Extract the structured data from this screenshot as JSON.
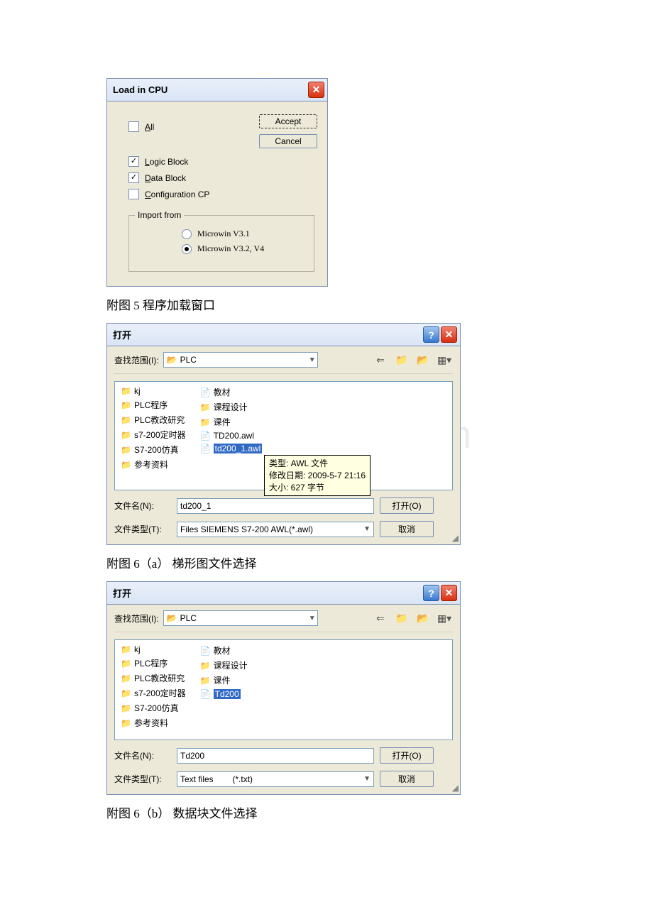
{
  "watermark": "www.bdocx.com",
  "load_dialog": {
    "title": "Load in CPU",
    "all": {
      "label_pre": "A",
      "label_post": "ll",
      "checked": false
    },
    "logic": {
      "label_pre": "L",
      "label_post": "ogic Block",
      "checked": true
    },
    "data": {
      "label_pre": "D",
      "label_post": "ata Block",
      "checked": true
    },
    "config": {
      "label_pre": "C",
      "label_post": "onfiguration CP",
      "checked": false
    },
    "accept": "Accept",
    "cancel": "Cancel",
    "import_legend": "Import from",
    "radio1": {
      "label": "Microwin V3.1",
      "checked": false
    },
    "radio2": {
      "label": "Microwin V3.2, V4",
      "checked": true
    }
  },
  "caption1": "附图 5 程序加载窗口",
  "open1": {
    "title": "打开",
    "range_label": "查找范围(I):",
    "range_value": "PLC",
    "col1": [
      "kj",
      "PLC程序",
      "PLC教改研究",
      "s7-200定时器",
      "S7-200仿真",
      "参考资料"
    ],
    "col2": [
      {
        "icon": "doc",
        "text": "教材"
      },
      {
        "icon": "folder",
        "text": "课程设计"
      },
      {
        "icon": "folder",
        "text": "课件"
      },
      {
        "icon": "doc",
        "text": "TD200.awl"
      },
      {
        "icon": "doc",
        "text": "td200_1.awl",
        "selected": true
      }
    ],
    "tooltip": {
      "l1": "类型: AWL 文件",
      "l2": "修改日期: 2009-5-7 21:16",
      "l3": "大小: 627 字节"
    },
    "filename_label": "文件名(N):",
    "filename_value": "td200_1",
    "filetype_label": "文件类型(T):",
    "filetype_value": "Files SIEMENS S7-200 AWL(*.awl)",
    "open_btn": "打开(O)",
    "cancel_btn": "取消"
  },
  "caption2": "附图 6（a） 梯形图文件选择",
  "open2": {
    "title": "打开",
    "range_label": "查找范围(I):",
    "range_value": "PLC",
    "col1": [
      "kj",
      "PLC程序",
      "PLC教改研究",
      "s7-200定时器",
      "S7-200仿真",
      "参考资料"
    ],
    "col2": [
      {
        "icon": "doc",
        "text": "教材"
      },
      {
        "icon": "folder",
        "text": "课程设计"
      },
      {
        "icon": "folder",
        "text": "课件"
      },
      {
        "icon": "txt",
        "text": "Td200",
        "selected": true
      }
    ],
    "filename_label": "文件名(N):",
    "filename_value": "Td200",
    "filetype_label": "文件类型(T):",
    "filetype_value": "Text files        (*.txt)",
    "open_btn": "打开(O)",
    "cancel_btn": "取消"
  },
  "caption3": "附图 6（b） 数据块文件选择"
}
